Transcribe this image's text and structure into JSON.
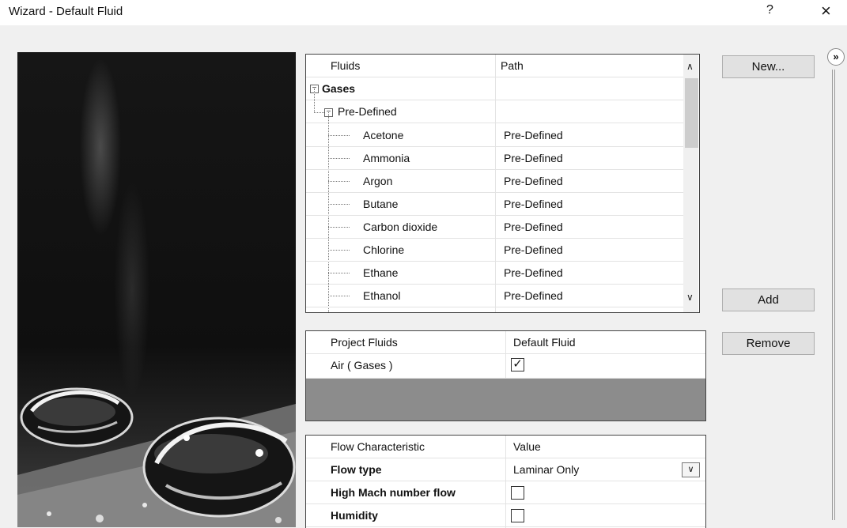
{
  "window": {
    "title": "Wizard - Default Fluid",
    "help_label": "?",
    "close_label": "×"
  },
  "fluids_table": {
    "headers": [
      "Fluids",
      "Path"
    ],
    "tree": {
      "gases_label": "Gases",
      "predefined_label": "Pre-Defined"
    },
    "rows": [
      {
        "name": "Acetone",
        "path": "Pre-Defined"
      },
      {
        "name": "Ammonia",
        "path": "Pre-Defined"
      },
      {
        "name": "Argon",
        "path": "Pre-Defined"
      },
      {
        "name": "Butane",
        "path": "Pre-Defined"
      },
      {
        "name": "Carbon dioxide",
        "path": "Pre-Defined"
      },
      {
        "name": "Chlorine",
        "path": "Pre-Defined"
      },
      {
        "name": "Ethane",
        "path": "Pre-Defined"
      },
      {
        "name": "Ethanol",
        "path": "Pre-Defined"
      }
    ],
    "scroll_up": "∧",
    "scroll_down": "∨",
    "expander_glyph": "−"
  },
  "project_fluids": {
    "headers": [
      "Project Fluids",
      "Default Fluid"
    ],
    "rows": [
      {
        "name": "Air ( Gases )",
        "default_checked": true,
        "check_glyph": "✓"
      }
    ]
  },
  "flow_table": {
    "headers": [
      "Flow Characteristic",
      "Value"
    ],
    "rows": [
      {
        "name": "Flow type",
        "value": "Laminar Only",
        "control": "combo"
      },
      {
        "name": "High Mach number flow",
        "value": "",
        "control": "checkbox",
        "checked": false
      },
      {
        "name": "Humidity",
        "value": "",
        "control": "checkbox",
        "checked": false
      }
    ],
    "combo_glyph": "∨"
  },
  "buttons": {
    "new": "New...",
    "add": "Add",
    "remove": "Remove"
  },
  "side_panel": {
    "expand_glyph": "»"
  }
}
